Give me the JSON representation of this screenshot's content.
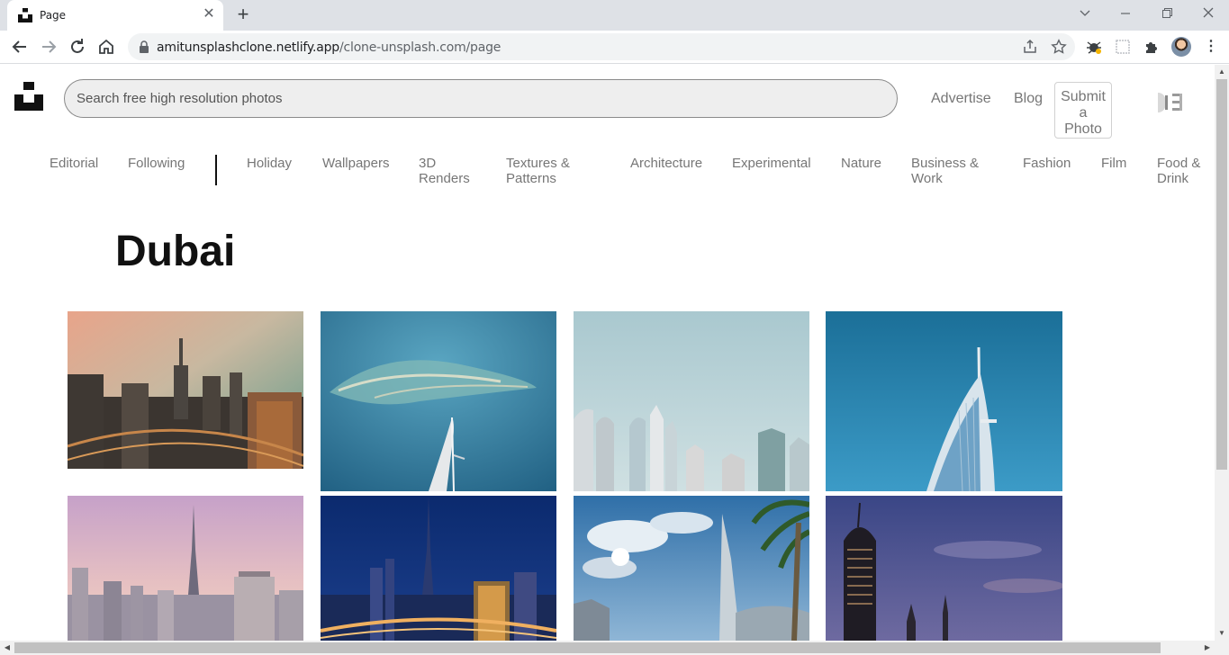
{
  "browser": {
    "tab_title": "Page",
    "tab_close_icon": "close-icon",
    "new_tab_label": "+",
    "url_host": "amitunsplashclone.netlify.app",
    "url_path": "/clone-unsplash.com/page",
    "window_controls": [
      "chevron-down-icon",
      "minimize-icon",
      "restore-icon",
      "close-icon"
    ]
  },
  "header": {
    "search_placeholder": "Search free high resolution photos",
    "nav": [
      "Advertise",
      "Blog"
    ],
    "submit_lines": [
      "Submit",
      "a",
      "Photo"
    ]
  },
  "categories": [
    "Editorial",
    "Following",
    "Holiday",
    "Wallpapers",
    "3D Renders",
    "Textures & Patterns",
    "Architecture",
    "Experimental",
    "Nature",
    "Business & Work",
    "Fashion",
    "Film",
    "Food & Drink"
  ],
  "page_title": "Dubai",
  "photos": [
    {
      "subject": "dubai-skyline-sunset"
    },
    {
      "subject": "palm-jumeirah-aerial"
    },
    {
      "subject": "marina-towers"
    },
    {
      "subject": "burj-al-arab"
    },
    {
      "subject": "burj-khalifa-dusk"
    },
    {
      "subject": "dubai-night-skyline"
    },
    {
      "subject": "burj-khalifa-palms"
    },
    {
      "subject": "tower-evening"
    }
  ],
  "colors": {
    "accent_text": "#767676",
    "heading": "#111111",
    "search_bg": "#eeeeee"
  }
}
